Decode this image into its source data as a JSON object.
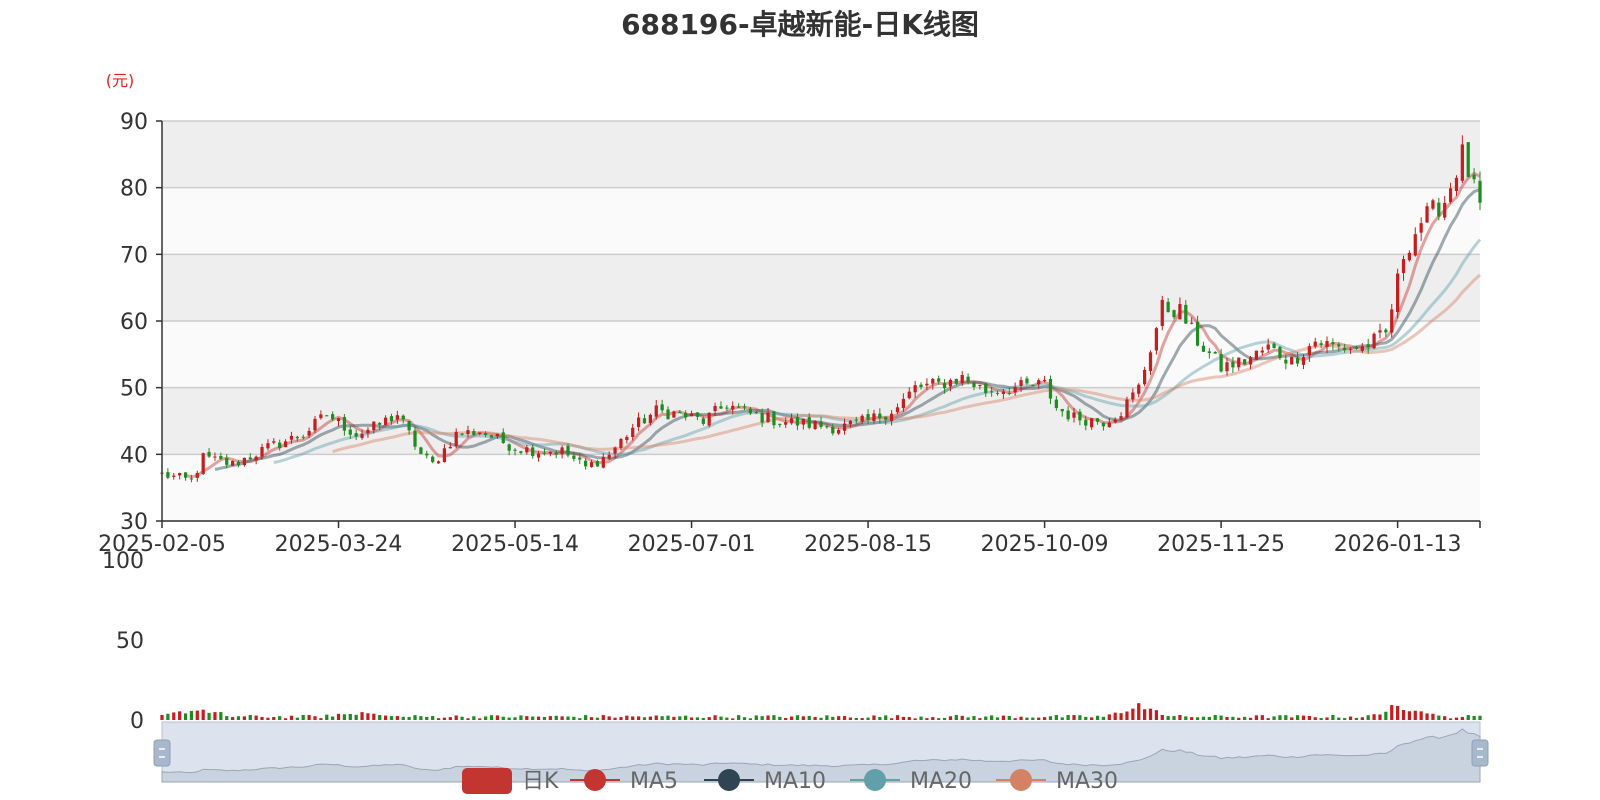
{
  "chart_data": {
    "type": "candlestick",
    "title": "688196-卓越新能-日K线图",
    "ylabel": "(元)",
    "ylim": [
      30,
      90
    ],
    "yticks": [
      30,
      40,
      50,
      60,
      70,
      80,
      90
    ],
    "volume_yticks": [
      0,
      50,
      100
    ],
    "volume_ylim": [
      0,
      100
    ],
    "x_tick_labels": [
      "2025-02-05",
      "2025-03-24",
      "2025-05-14",
      "2025-07-01",
      "2025-08-15",
      "2025-10-09",
      "2025-11-25",
      "2026-01-13"
    ],
    "x_tick_positions": [
      0,
      30,
      60,
      90,
      120,
      150,
      180,
      210
    ],
    "n_candles": 225,
    "close_anchors": [
      [
        0,
        37.0
      ],
      [
        5,
        36.0
      ],
      [
        7,
        39.5
      ],
      [
        12,
        38.5
      ],
      [
        18,
        41.0
      ],
      [
        24,
        43.0
      ],
      [
        28,
        46.0
      ],
      [
        33,
        43.0
      ],
      [
        36,
        44.0
      ],
      [
        40,
        46.0
      ],
      [
        44,
        40.0
      ],
      [
        46,
        38.5
      ],
      [
        50,
        43.0
      ],
      [
        54,
        43.5
      ],
      [
        60,
        41.0
      ],
      [
        64,
        40.5
      ],
      [
        68,
        40.5
      ],
      [
        72,
        38.0
      ],
      [
        76,
        40.0
      ],
      [
        80,
        44.0
      ],
      [
        84,
        46.5
      ],
      [
        88,
        46.0
      ],
      [
        92,
        45.0
      ],
      [
        96,
        47.5
      ],
      [
        100,
        46.0
      ],
      [
        105,
        45.0
      ],
      [
        110,
        44.5
      ],
      [
        115,
        44.0
      ],
      [
        120,
        45.0
      ],
      [
        125,
        47.0
      ],
      [
        128,
        50.0
      ],
      [
        132,
        50.5
      ],
      [
        136,
        51.5
      ],
      [
        140,
        49.5
      ],
      [
        145,
        50.0
      ],
      [
        150,
        50.5
      ],
      [
        152,
        47.0
      ],
      [
        155,
        45.5
      ],
      [
        160,
        45.0
      ],
      [
        163,
        46.5
      ],
      [
        166,
        50.0
      ],
      [
        170,
        62.0
      ],
      [
        173,
        61.5
      ],
      [
        176,
        57.0
      ],
      [
        180,
        53.0
      ],
      [
        184,
        54.0
      ],
      [
        188,
        56.0
      ],
      [
        192,
        54.0
      ],
      [
        196,
        57.0
      ],
      [
        200,
        56.0
      ],
      [
        204,
        56.0
      ],
      [
        208,
        58.0
      ],
      [
        211,
        70.0
      ],
      [
        214,
        75.0
      ],
      [
        218,
        78.0
      ],
      [
        221,
        85.0
      ],
      [
        224,
        77.0
      ]
    ],
    "volume_peaks": [
      [
        6,
        7
      ],
      [
        33,
        5
      ],
      [
        166,
        9
      ],
      [
        211,
        10
      ]
    ],
    "series": [
      {
        "name": "日K",
        "color": "#c23531"
      },
      {
        "name": "MA5",
        "color": "#c23531"
      },
      {
        "name": "MA10",
        "color": "#2f4554"
      },
      {
        "name": "MA20",
        "color": "#61a0a8"
      },
      {
        "name": "MA30",
        "color": "#d48265"
      }
    ],
    "up_color": "#c41e1e",
    "down_color": "#1e8c1e",
    "legend_position": "bottom"
  }
}
